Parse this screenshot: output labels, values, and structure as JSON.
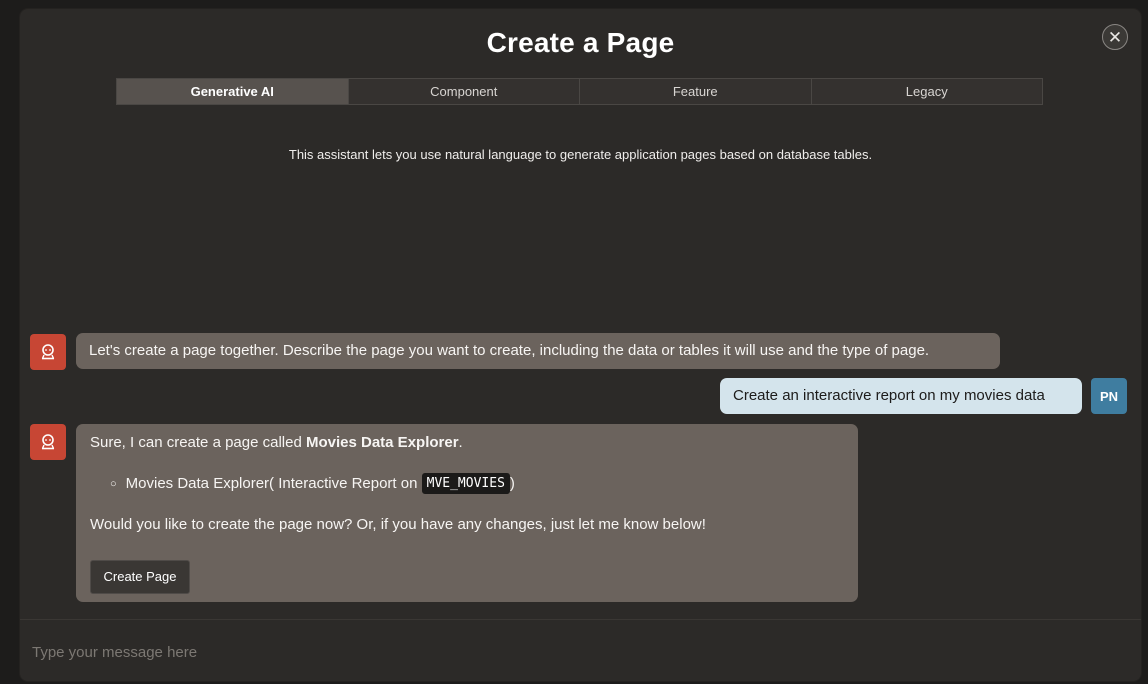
{
  "dialog": {
    "title": "Create a Page",
    "close_icon": "close-icon"
  },
  "tabs": [
    {
      "label": "Generative AI",
      "active": true
    },
    {
      "label": "Component",
      "active": false
    },
    {
      "label": "Feature",
      "active": false
    },
    {
      "label": "Legacy",
      "active": false
    }
  ],
  "intro_text": "This assistant lets you use natural language to generate application pages based on database tables.",
  "conversation": {
    "bot_avatar_icon": "assistant-robot-icon",
    "message1": "Let's create a page together. Describe the page you want to create, including the data or tables it will use and the type of page.",
    "user_message": "Create an interactive report on my movies data",
    "user_initials": "PN",
    "message2": {
      "lead": "Sure, I can create a page called ",
      "page_name": "Movies Data Explorer",
      "lead_end": ".",
      "bullet_name": "Movies Data Explorer",
      "bullet_mid": " ( Interactive Report on ",
      "table_name": "MVE_MOVIES",
      "bullet_end": " )",
      "question": "Would you like to create the page now? Or, if you have any changes, just let me know below!",
      "button_label": "Create Page"
    }
  },
  "composer": {
    "placeholder": "Type your message here"
  },
  "colors": {
    "accent_bot": "#c74634",
    "user_avatar": "#3f7da0",
    "user_bubble": "#d4e4ec",
    "bot_bubble": "#6b635d"
  }
}
